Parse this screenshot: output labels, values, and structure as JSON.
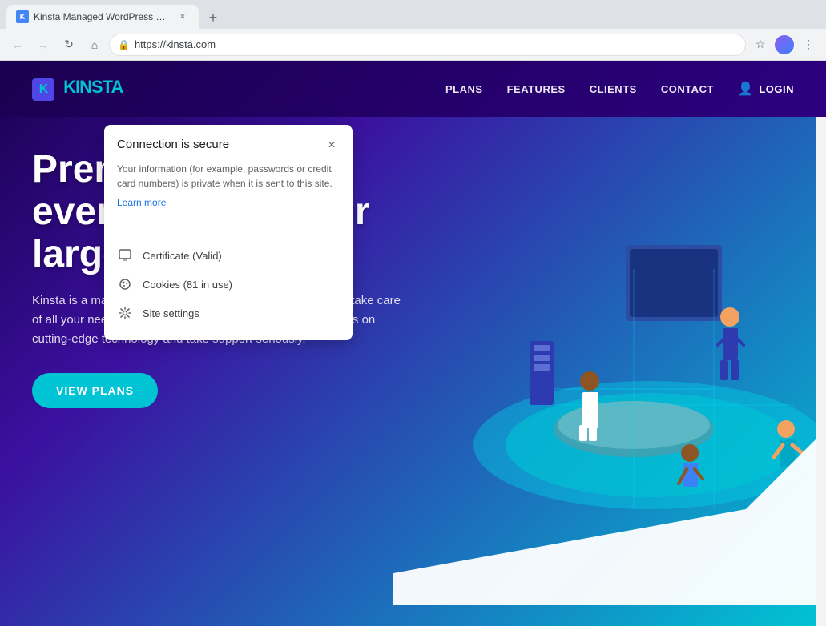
{
  "browser": {
    "tab": {
      "favicon_label": "K",
      "title": "Kinsta Managed WordPress Hos…",
      "close_label": "×"
    },
    "new_tab_label": "+",
    "nav": {
      "back_label": "←",
      "forward_label": "→",
      "reload_label": "↻",
      "home_label": "⌂",
      "url": "https://kinsta.com",
      "star_label": "☆",
      "menu_label": "⋮"
    }
  },
  "header": {
    "logo_k": "K",
    "logo_text": "KINSTA",
    "nav_items": [
      "PLANS",
      "FEATURES",
      "CLIENTS",
      "CONTACT"
    ],
    "login_label": "LOGIN"
  },
  "hero": {
    "title": "Premi hosting for everyone, small or large",
    "description": "Kinsta is a managed WordPress hosting provider that helps take care of all your needs regarding your website. We run our services on cutting-edge technology and take support seriously.",
    "cta_label": "VIEW PLANS"
  },
  "popup": {
    "title": "Connection is secure",
    "close_label": "×",
    "description": "Your information (for example, passwords or credit card numbers) is private when it is sent to this site.",
    "learn_more_label": "Learn more",
    "items": [
      {
        "icon": "cert",
        "label": "Certificate",
        "detail": "(Valid)"
      },
      {
        "icon": "cookie",
        "label": "Cookies",
        "detail": "(81 in use)"
      },
      {
        "icon": "gear",
        "label": "Site settings",
        "detail": ""
      }
    ]
  }
}
